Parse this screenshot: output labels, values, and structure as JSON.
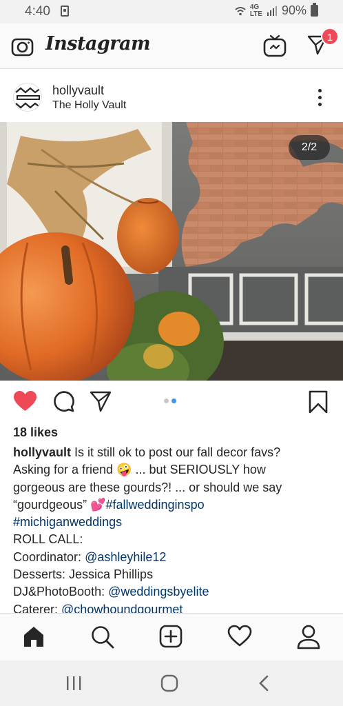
{
  "status_bar": {
    "time": "4:40",
    "network": "4G\nLTE",
    "battery": "90%"
  },
  "header": {
    "brand": "Instagram",
    "notification_count": "1",
    "icons": [
      "camera-icon",
      "igtv-icon",
      "direct-message-icon"
    ]
  },
  "post": {
    "username": "hollyvault",
    "location": "The Holly Vault",
    "media_counter": "2/2",
    "carousel": {
      "total": 2,
      "current": 2
    },
    "liked": true,
    "likes": "18 likes",
    "caption": {
      "username": "hollyvault",
      "text_1": " Is it still ok to post our fall decor favs?",
      "text_2": "Asking for a friend 🤪 ... but SERIOUSLY how",
      "text_3": "gorgeous are these gourds?! ... or should we say",
      "text_4a": "“gourdgeous” 💕",
      "hashtag_1": "#fallweddinginspo",
      "hashtag_2": "#michiganweddings",
      "roll_call": "ROLL CALL:",
      "coordinator_label": "Coordinator: ",
      "coordinator_handle": "@ashleyhile12",
      "desserts": "Desserts: Jessica Phillips",
      "dj_label": "DJ&PhotoBooth: ",
      "dj_handle": "@weddingsbyelite",
      "caterer_label": "Caterer: ",
      "caterer_handle": "@chowhoundgourmet"
    }
  },
  "colors": {
    "like_red": "#ed4956",
    "link_blue": "#003569",
    "dot_active": "#3897f0"
  }
}
